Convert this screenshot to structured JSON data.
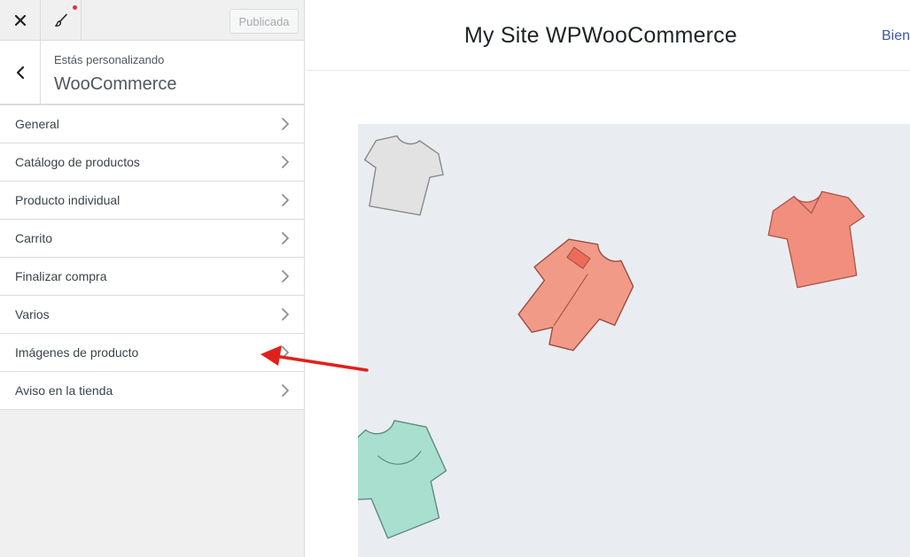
{
  "customizer": {
    "publish_label": "Publicada",
    "panel_subtitle": "Estás personalizando",
    "panel_title": "WooCommerce",
    "menu": [
      {
        "label": "General"
      },
      {
        "label": "Catálogo de productos"
      },
      {
        "label": "Producto individual"
      },
      {
        "label": "Carrito"
      },
      {
        "label": "Finalizar compra"
      },
      {
        "label": "Varios"
      },
      {
        "label": "Imágenes de producto"
      },
      {
        "label": "Aviso en la tienda"
      }
    ]
  },
  "preview": {
    "site_title": "My Site WPWooCommerce",
    "nav_partial": "Bienv"
  },
  "colors": {
    "annotation_arrow": "#e0201b",
    "notification_dot": "#d63638",
    "hero_bg": "#e9edf2",
    "shirt_coral": "#f08b7b",
    "shirt_gray": "#e2e2e2",
    "shirt_mint": "#a9dfcf"
  }
}
